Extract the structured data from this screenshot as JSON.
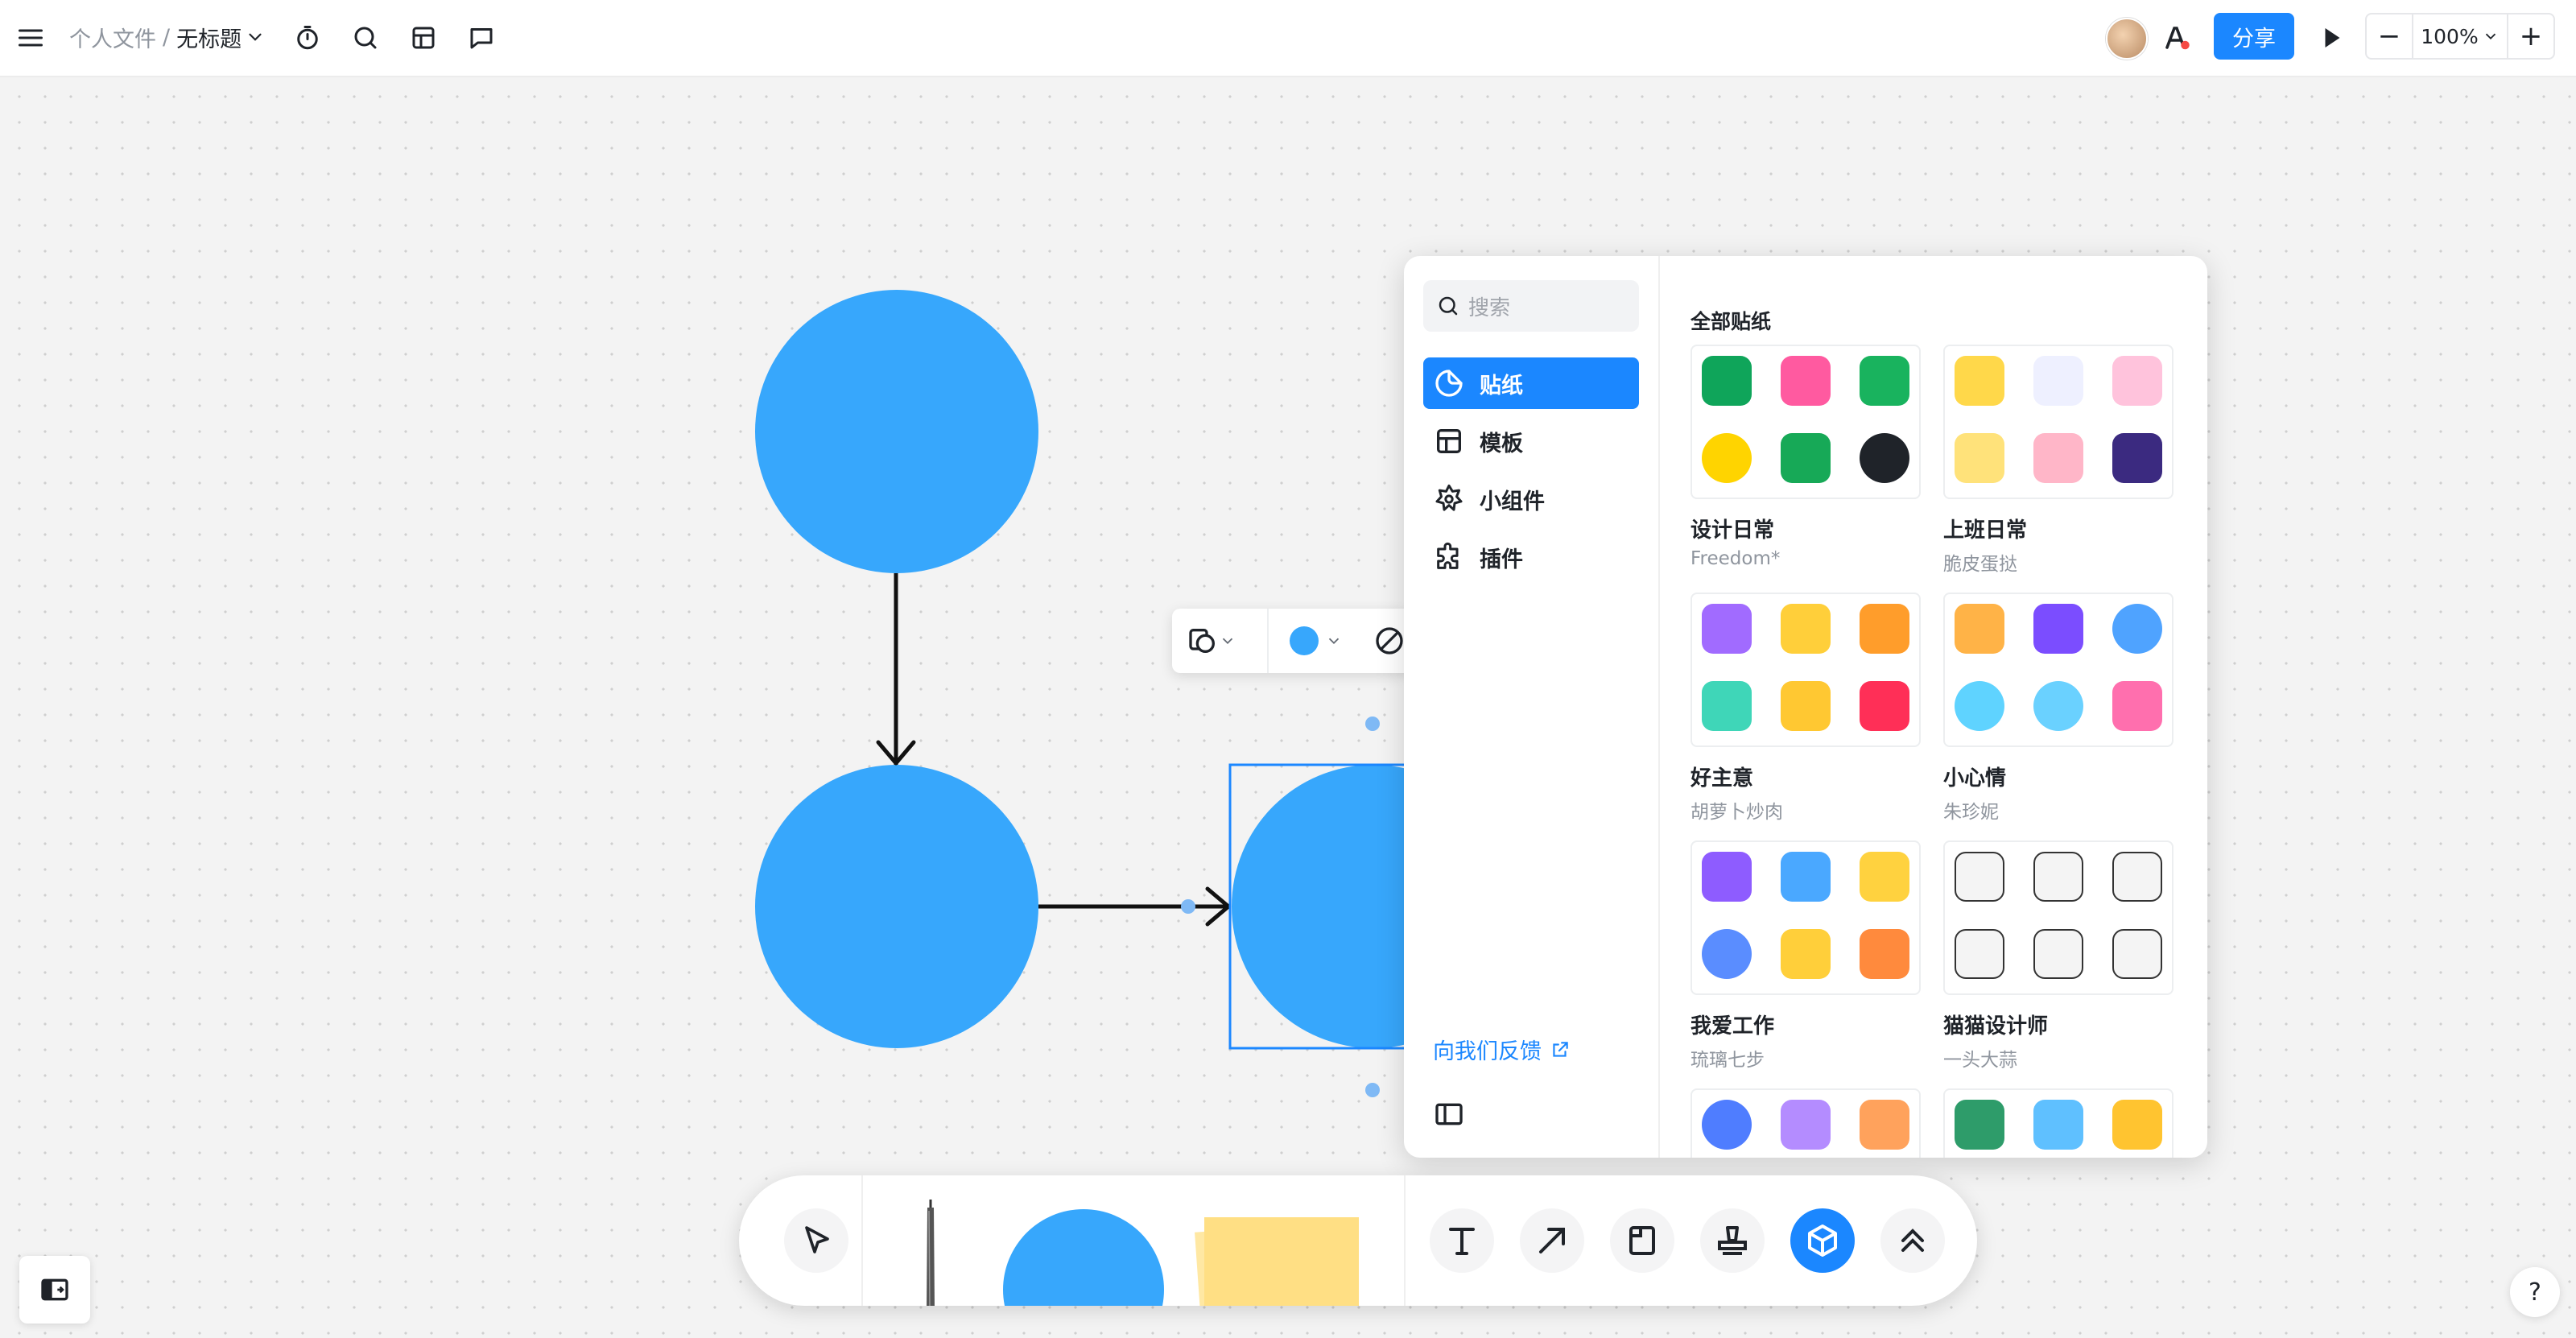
{
  "breadcrumb": {
    "folder": "个人文件",
    "separator": "/",
    "title": "无标题"
  },
  "header": {
    "share_label": "分享",
    "zoom_value": "100%",
    "zoom_out": "−",
    "zoom_in": "+"
  },
  "panel": {
    "search_placeholder": "搜索",
    "nav": [
      {
        "label": "贴纸",
        "icon": "sticker-icon",
        "active": true
      },
      {
        "label": "模板",
        "icon": "template-icon"
      },
      {
        "label": "小组件",
        "icon": "widget-icon"
      },
      {
        "label": "插件",
        "icon": "plugin-icon"
      }
    ],
    "feedback_label": "向我们反馈",
    "section_title": "全部贴纸",
    "packs": [
      {
        "name": "设计日常",
        "author": "Freedom*"
      },
      {
        "name": "上班日常",
        "author": "脆皮蛋挞"
      },
      {
        "name": "好主意",
        "author": "胡萝卜炒肉"
      },
      {
        "name": "小心情",
        "author": "朱珍妮"
      },
      {
        "name": "我爱工作",
        "author": "琉璃七步"
      },
      {
        "name": "猫猫设计师",
        "author": "一头大蒜"
      }
    ]
  },
  "colors": {
    "accent": "#1b87ff",
    "shape_fill": "#37a7fc",
    "sticky_note": "#ffe08a"
  },
  "help_label": "?"
}
